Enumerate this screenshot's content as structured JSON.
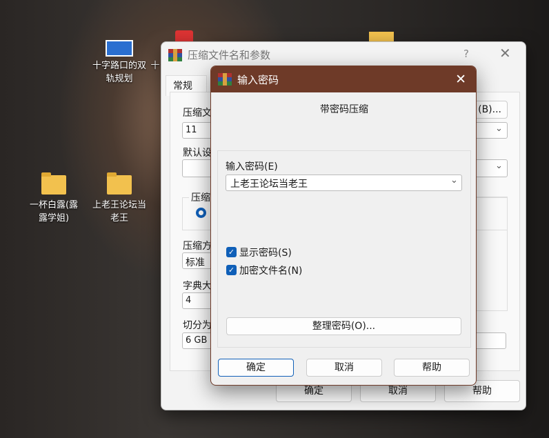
{
  "desktop": {
    "icons": [
      {
        "label1": "十字路口的双",
        "label2": "轨规划"
      },
      {
        "label1": "一杯白露(露",
        "label2": "露学姐)"
      },
      {
        "label1": "上老王论坛当",
        "label2": "老王"
      }
    ],
    "partial": "十"
  },
  "main_window": {
    "title": "压缩文件名和参数",
    "help": "?",
    "tab": "常规",
    "archive_name_label": "压缩文",
    "archive_name_value": "11",
    "browse_suffix": "(B)...",
    "default_label": "默认设",
    "format_label": "压缩",
    "method_label": "压缩方",
    "method_value": "标准",
    "dict_label": "字典大",
    "dict_value": "4",
    "split_label": "切分为",
    "split_value": "6 GB",
    "ok": "确定",
    "cancel": "取消",
    "help_btn": "帮助"
  },
  "dialog": {
    "title": "输入密码",
    "heading": "带密码压缩",
    "password_label": "输入密码(E)",
    "password_value": "上老王论坛当老王",
    "show_password": {
      "label": "显示密码(S)",
      "checked": true
    },
    "encrypt_names": {
      "label": "加密文件名(N)",
      "checked": true
    },
    "organize": "整理密码(O)...",
    "ok": "确定",
    "cancel": "取消",
    "help": "帮助",
    "title_color": "#6e3a28"
  }
}
